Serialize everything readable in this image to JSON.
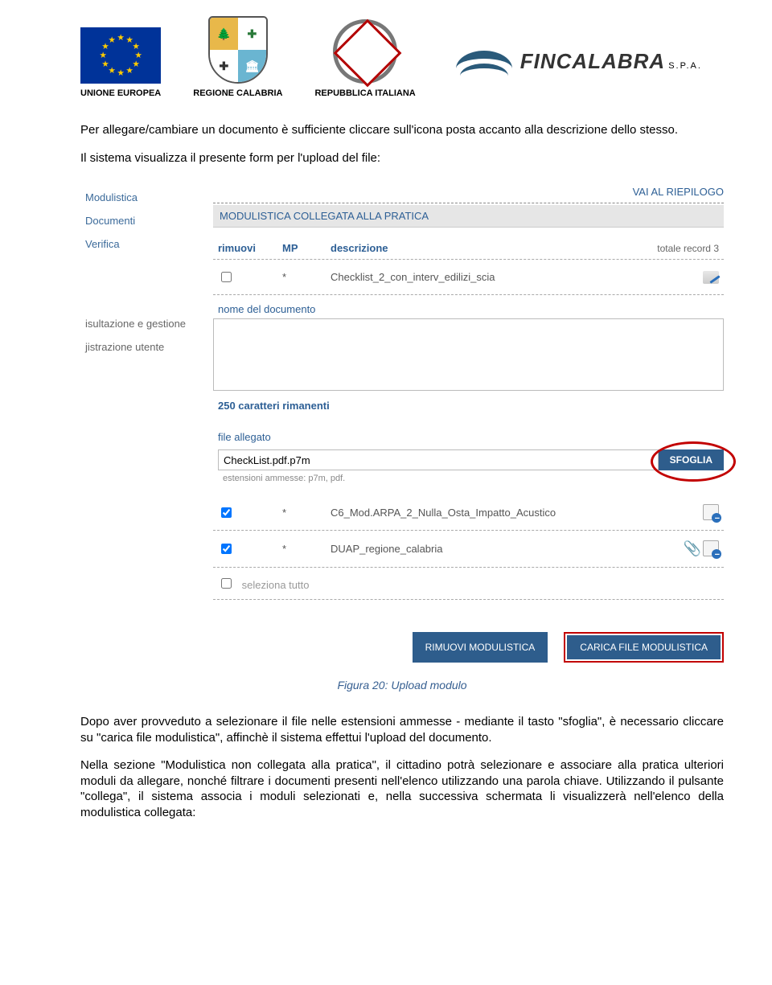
{
  "header": {
    "eu": "UNIONE EUROPEA",
    "calabria": "REGIONE CALABRIA",
    "italia": "REPUBBLICA ITALIANA",
    "fincalabra": "FINCALABRA",
    "fincalabra_spa": "S.P.A."
  },
  "intro_p1": "Per allegare/cambiare un documento è sufficiente cliccare sull'icona posta accanto alla descrizione dello stesso.",
  "intro_p2": "Il sistema visualizza il presente form per l'upload del file:",
  "sidebar": {
    "items": [
      "Modulistica",
      "Documenti",
      "Verifica"
    ],
    "items_gray": [
      "isultazione e gestione",
      "jistrazione utente"
    ]
  },
  "panel": {
    "riepilogo": "VAI AL RIEPILOGO",
    "title": "MODULISTICA COLLEGATA ALLA PRATICA",
    "cols": {
      "rimuovi": "rimuovi",
      "mp": "MP",
      "desc": "descrizione",
      "total": "totale record 3"
    },
    "rows": [
      {
        "mp": "*",
        "desc": "Checklist_2_con_interv_edilizi_scia",
        "checked": false,
        "icons": [
          "edit"
        ]
      },
      {
        "mp": "*",
        "desc": "C6_Mod.ARPA_2_Nulla_Osta_Impatto_Acustico",
        "checked": true,
        "icons": [
          "docminus"
        ]
      },
      {
        "mp": "*",
        "desc": "DUAP_regione_calabria",
        "checked": true,
        "icons": [
          "clip",
          "docminus"
        ]
      }
    ],
    "nome_label": "nome del documento",
    "char_count": "250 caratteri rimanenti",
    "file_label": "file allegato",
    "file_value": "CheckList.pdf.p7m",
    "sfoglia": "SFOGLIA",
    "ext_note": "estensioni ammesse: p7m, pdf.",
    "sel_all": "seleziona tutto",
    "btn_rimuovi": "RIMUOVI MODULISTICA",
    "btn_carica": "CARICA FILE MODULISTICA"
  },
  "caption": "Figura 20: Upload modulo",
  "para_after": {
    "p1a": "Dopo aver provveduto a selezionare il file nelle estensioni ammesse - mediante il tasto \"sfoglia\", è necessario cliccare su \"carica file modulistica\", affinchè il sistema effettui l'upload del documento.",
    "p2": "Nella sezione \"Modulistica non collegata alla pratica\", il cittadino potrà selezionare e associare alla pratica ulteriori moduli da allegare, nonché filtrare i documenti presenti nell'elenco utilizzando una parola chiave. Utilizzando il pulsante \"collega\", il sistema associa i moduli selezionati e, nella successiva schermata li visualizzerà nell'elenco della modulistica collegata:"
  }
}
